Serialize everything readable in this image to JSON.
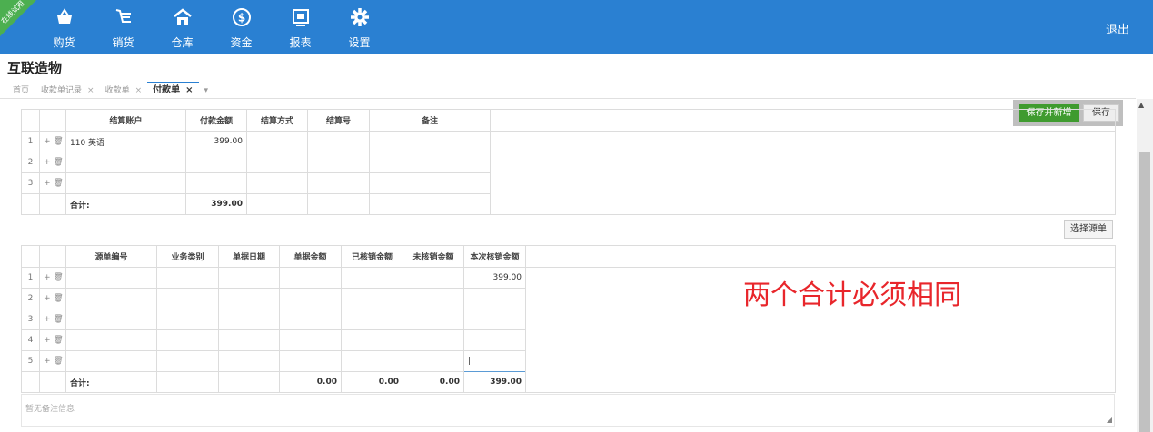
{
  "ribbon_text": "在线试用",
  "nav": [
    {
      "label": "购货",
      "icon": "basket-icon",
      "glyph": "🧺"
    },
    {
      "label": "销货",
      "icon": "cart-icon",
      "glyph": "⊭"
    },
    {
      "label": "仓库",
      "icon": "warehouse-icon",
      "glyph": "⌂"
    },
    {
      "label": "资金",
      "icon": "dollar-icon",
      "glyph": "$"
    },
    {
      "label": "报表",
      "icon": "report-icon",
      "glyph": "▤"
    },
    {
      "label": "设置",
      "icon": "gear-icon",
      "glyph": "⚙"
    }
  ],
  "logout": "退出",
  "company": "互联造物",
  "tabs": [
    {
      "label": "首页"
    },
    {
      "label": "收款单记录"
    },
    {
      "label": "收款单"
    },
    {
      "label": "付款单"
    }
  ],
  "buttons": {
    "save_new": "保存并新增",
    "save": "保存",
    "select_source": "选择源单"
  },
  "table1": {
    "headers": [
      "结算账户",
      "付款金额",
      "结算方式",
      "结算号",
      "备注"
    ],
    "rows": [
      {
        "n": "1",
        "account": "110 英语",
        "amount": "399.00"
      },
      {
        "n": "2",
        "account": "",
        "amount": ""
      },
      {
        "n": "3",
        "account": "",
        "amount": ""
      }
    ],
    "total_label": "合计:",
    "total": "399.00"
  },
  "table2": {
    "headers": [
      "源单编号",
      "业务类别",
      "单据日期",
      "单据金额",
      "已核销金额",
      "未核销金额",
      "本次核销金额"
    ],
    "rows": [
      {
        "n": "1",
        "this": "399.00"
      },
      {
        "n": "2",
        "this": ""
      },
      {
        "n": "3",
        "this": ""
      },
      {
        "n": "4",
        "this": ""
      },
      {
        "n": "5",
        "this": ""
      }
    ],
    "total_label": "合计:",
    "totals": {
      "doc": "0.00",
      "written": "0.00",
      "unwritten": "0.00",
      "this": "399.00"
    }
  },
  "annotation": "两个合计必须相同",
  "remark_placeholder": "暂无备注信息",
  "colors": {
    "topbar": "#2a80d2",
    "green_button": "#3f9b2f",
    "annotation": "#e8262b"
  }
}
